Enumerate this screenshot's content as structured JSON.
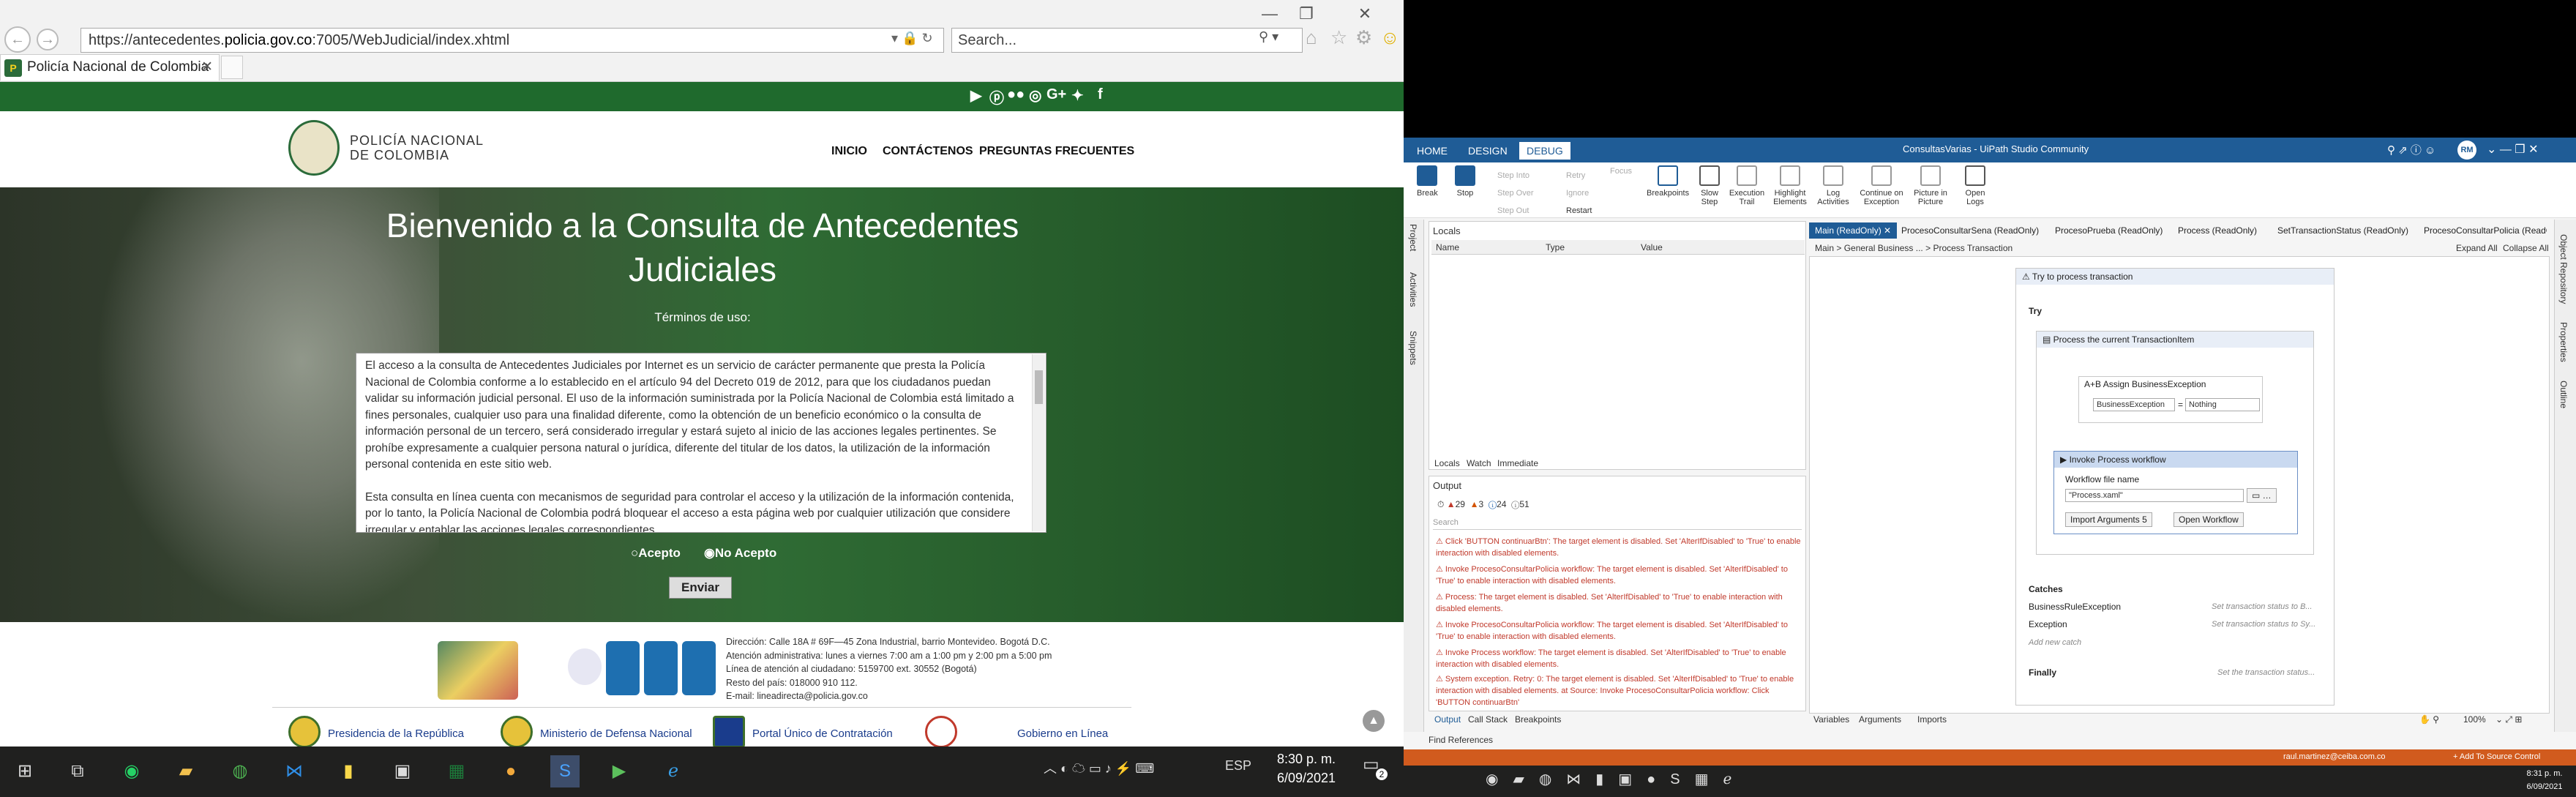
{
  "browser": {
    "url_prefix": "https://antecedentes.",
    "url_domain": "policia.gov.co",
    "url_suffix": ":7005/WebJudicial/index.xhtml",
    "search_placeholder": "Search...",
    "tab_title": "Policía Nacional de Colombia"
  },
  "site": {
    "logo_line1": "POLICÍA NACIONAL",
    "logo_line2": "DE COLOMBIA",
    "menu": [
      "INICIO",
      "CONTÁCTENOS",
      "PREGUNTAS FRECUENTES"
    ],
    "hero_title_1": "Bienvenido a la Consulta de Antecedentes",
    "hero_title_2": "Judiciales",
    "terms_label": "Términos de uso:",
    "terms_p1": "El acceso a la consulta de Antecedentes Judiciales por Internet es un servicio de carácter permanente que presta la Policía Nacional de Colombia conforme a lo establecido en el artículo 94 del Decreto 019 de 2012, para que los ciudadanos puedan validar su información judicial personal. El uso de la información suministrada por la Policía Nacional de Colombia está limitado a fines personales, cualquier uso para una finalidad diferente, como la obtención de un beneficio económico o la consulta de información personal de un tercero, será considerado irregular y estará sujeto al inicio de las acciones legales pertinentes. Se prohíbe expresamente a cualquier persona natural o jurídica, diferente del titular de los datos, la utilización de la información personal contenida en este sitio web.",
    "terms_p2": "Esta consulta en línea cuenta con mecanismos de seguridad para controlar el acceso y la utilización de la información contenida, por lo tanto, la Policía Nacional de Colombia podrá bloquear el acceso a esta página web por cualquier utilización que considere irregular y entablar las acciones legales correspondientes.",
    "radio_accept": "Acepto",
    "radio_reject": "No Acepto",
    "submit": "Enviar",
    "footer_lines": [
      "Dirección: Calle 18A # 69F—45 Zona Industrial, barrio Montevideo. Bogotá D.C.",
      "Atención administrativa: lunes a viernes 7:00 am a 1:00 pm y 2:00 pm a 5:00 pm",
      "Línea de atención al ciudadano: 5159700 ext. 30552 (Bogotá)",
      "Resto del país: 018000 910 112.",
      "E-mail: lineadirecta@policia.gov.co"
    ],
    "footer_links": [
      "Presidencia de la República",
      "Ministerio de Defensa Nacional",
      "Portal Único de Contratación",
      "Gobierno en Línea"
    ]
  },
  "taskbar_left": {
    "lang": "ESP",
    "time": "8:30 p. m.",
    "date": "6/09/2021",
    "notif_count": "2"
  },
  "uipath": {
    "title": "ConsultasVarias - UiPath Studio Community",
    "ribbon_tabs": [
      "HOME",
      "DESIGN",
      "DEBUG"
    ],
    "user_initials": "RM",
    "ribbon_buttons": [
      "Break",
      "Stop",
      "Step Into",
      "Step Over",
      "Step Out",
      "Retry",
      "Ignore",
      "Restart",
      "Focus",
      "Breakpoints",
      "Slow Step",
      "Execution Trail",
      "Highlight Elements",
      "Log Activities",
      "Continue on Exception",
      "Picture in Picture",
      "Open Logs"
    ],
    "side_panels": [
      "Project",
      "Activities",
      "Snippets"
    ],
    "right_side_panels": [
      "Object Repository",
      "Properties",
      "Outline"
    ],
    "locals_title": "Locals",
    "locals_cols": [
      "Name",
      "Type",
      "Value"
    ],
    "locals_tabs": [
      "Locals",
      "Watch",
      "Immediate"
    ],
    "output_title": "Output",
    "output_counts": [
      "29",
      "3",
      "24",
      "51"
    ],
    "search_placeholder": "Search",
    "output_lines": [
      "Click 'BUTTON  continuarBtn': The target element is disabled. Set 'AlterIfDisabled' to 'True' to enable interaction with disabled elements.",
      "Invoke ProcesoConsultarPolicia workflow: The target element is disabled. Set 'AlterIfDisabled' to 'True' to enable interaction with disabled elements.",
      "Process: The target element is disabled. Set 'AlterIfDisabled' to 'True' to enable interaction with disabled elements.",
      "Invoke ProcesoConsultarPolicia workflow: The target element is disabled. Set 'AlterIfDisabled' to 'True' to enable interaction with disabled elements.",
      "Invoke Process workflow: The target element is disabled. Set 'AlterIfDisabled' to 'True' to enable interaction with disabled elements.",
      "System exception. Retry: 0: The target element is disabled. Set 'AlterIfDisabled' to 'True' to enable interaction with disabled elements. at Source: Invoke ProcesoConsultarPolicia workflow: Click 'BUTTON  continuarBtn'"
    ],
    "bottom_tabs": [
      "Output",
      "Call Stack",
      "Breakpoints"
    ],
    "find_refs": "Find References",
    "doc_tabs": [
      "Main (ReadOnly)",
      "ProcesoConsultarSena (ReadOnly)",
      "ProcesoPrueba (ReadOnly)",
      "Process (ReadOnly)",
      "SetTransactionStatus (ReadOnly)",
      "ProcesoConsultarPolicia (ReadOnly)"
    ],
    "breadcrumb": [
      "Main",
      "General Business ...",
      "Process Transaction"
    ],
    "expand_all": "Expand All",
    "collapse_all": "Collapse All",
    "try_catch_title": "Try to process transaction",
    "try_label": "Try",
    "sequence_title": "Process the current TransactionItem",
    "assign_title": "Assign BusinessException",
    "assign_to": "BusinessException",
    "assign_val": "Nothing",
    "invoke_title": "Invoke Process workflow",
    "wf_label": "Workflow file name",
    "wf_value": "\"Process.xaml\"",
    "import_btn": "Import Arguments",
    "import_count": "5",
    "open_wf_btn": "Open Workflow",
    "catches": "Catches",
    "catch_rows": [
      {
        "name": "BusinessRuleException",
        "desc": "Set transaction status to B..."
      },
      {
        "name": "Exception",
        "desc": "Set transaction status to Sy..."
      }
    ],
    "add_catch": "Add new catch",
    "finally_label": "Finally",
    "finally_desc": "Set the transaction status...",
    "designer_tabs": [
      "Variables",
      "Arguments",
      "Imports"
    ],
    "zoom": "100%",
    "status_user": "raul.martinez@ceiba.com.co",
    "status_source": "+ Add To Source Control",
    "time": "8:31 p. m.",
    "date": "6/09/2021"
  }
}
